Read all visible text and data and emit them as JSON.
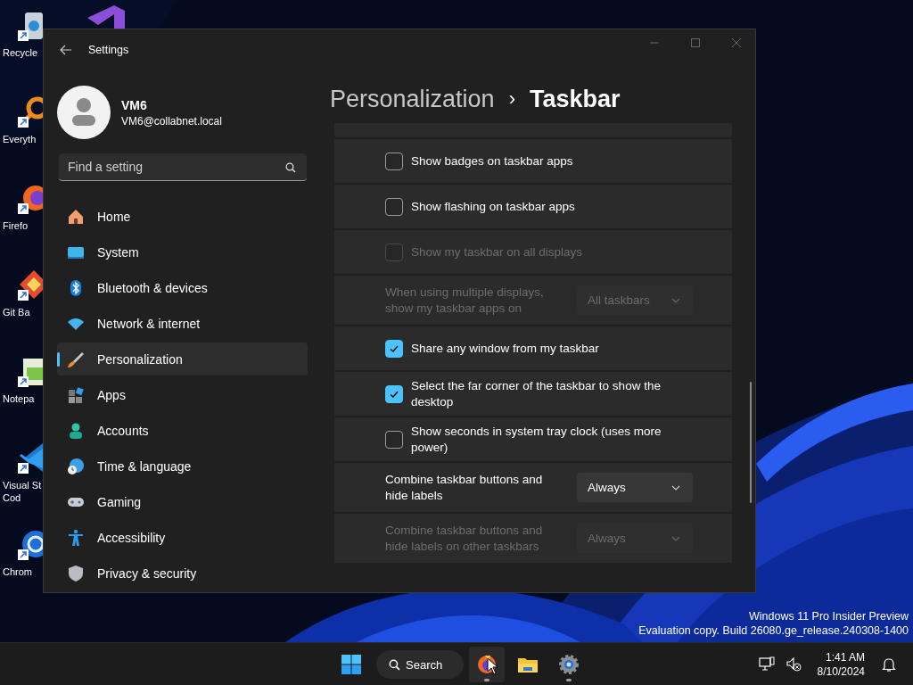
{
  "desktop": {
    "icons": [
      {
        "label": "Recycle"
      },
      {
        "label": "Everyth"
      },
      {
        "label": "Firefo"
      },
      {
        "label": "Git Ba"
      },
      {
        "label": "Notepa"
      },
      {
        "label": "Visual St\nCod"
      },
      {
        "label": "Chrom"
      }
    ],
    "watermark": [
      "Windows 11 Pro Insider Preview",
      "Evaluation copy. Build 26080.ge_release.240308-1400"
    ]
  },
  "window": {
    "title": "Settings"
  },
  "account": {
    "name": "VM6",
    "email": "VM6@collabnet.local"
  },
  "search": {
    "placeholder": "Find a setting"
  },
  "nav": [
    {
      "label": "Home",
      "selected": false
    },
    {
      "label": "System",
      "selected": false
    },
    {
      "label": "Bluetooth & devices",
      "selected": false
    },
    {
      "label": "Network & internet",
      "selected": false
    },
    {
      "label": "Personalization",
      "selected": true
    },
    {
      "label": "Apps",
      "selected": false
    },
    {
      "label": "Accounts",
      "selected": false
    },
    {
      "label": "Time & language",
      "selected": false
    },
    {
      "label": "Gaming",
      "selected": false
    },
    {
      "label": "Accessibility",
      "selected": false
    },
    {
      "label": "Privacy & security",
      "selected": false
    }
  ],
  "breadcrumb": {
    "parent": "Personalization",
    "separator": "›",
    "current": "Taskbar"
  },
  "settings": [
    {
      "kind": "checkbox",
      "label": "Show badges on taskbar apps",
      "checked": false,
      "disabled": false
    },
    {
      "kind": "checkbox",
      "label": "Show flashing on taskbar apps",
      "checked": false,
      "disabled": false
    },
    {
      "kind": "checkbox",
      "label": "Show my taskbar on all displays",
      "checked": false,
      "disabled": true
    },
    {
      "kind": "dropdown",
      "label": "When using multiple displays, show my taskbar apps on",
      "value": "All taskbars",
      "disabled": true
    },
    {
      "kind": "checkbox",
      "label": "Share any window from my taskbar",
      "checked": true,
      "disabled": false
    },
    {
      "kind": "checkbox",
      "label": "Select the far corner of the taskbar to show the desktop",
      "checked": true,
      "disabled": false
    },
    {
      "kind": "checkbox",
      "label": "Show seconds in system tray clock (uses more power)",
      "checked": false,
      "disabled": false
    },
    {
      "kind": "dropdown",
      "label": "Combine taskbar buttons and hide labels",
      "value": "Always",
      "disabled": false
    },
    {
      "kind": "dropdown",
      "label": "Combine taskbar buttons and hide labels on other taskbars",
      "value": "Always",
      "disabled": true
    }
  ],
  "taskbar": {
    "search": "Search",
    "apps": [
      {
        "running": true,
        "hovered": true
      },
      {
        "running": false,
        "hovered": false
      },
      {
        "running": true,
        "hovered": false
      }
    ],
    "time": "1:41 AM",
    "date": "8/10/2024"
  }
}
